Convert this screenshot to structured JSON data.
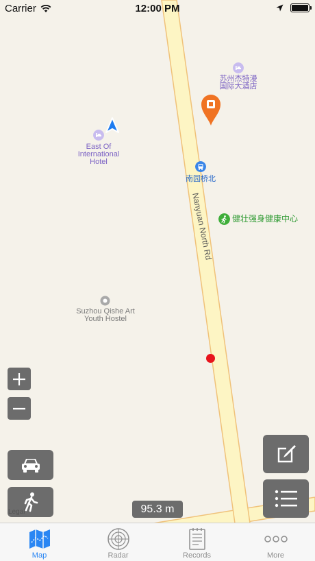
{
  "status_bar": {
    "carrier": "Carrier",
    "time": "12:00 PM"
  },
  "map": {
    "road_name": "Nanyuan North Rd",
    "pois": [
      {
        "id": "suzhou-hotel",
        "label_line1": "苏州杰特漫",
        "label_line2": "国际大酒店",
        "category": "hotel"
      },
      {
        "id": "east-of-international",
        "label_line1": "East Of",
        "label_line2": "International",
        "label_line3": "Hotel",
        "category": "hotel"
      },
      {
        "id": "bus-stop",
        "label_line1": "南园桥北",
        "category": "bus-stop"
      },
      {
        "id": "fitness-center",
        "label_line1": "健壮强身健康中心",
        "category": "fitness"
      },
      {
        "id": "youth-hostel",
        "label_line1": "Suzhou Qishe Art",
        "label_line2": "Youth Hostel",
        "category": "hostel"
      }
    ],
    "legal": "Legal",
    "scale": "95.3 m",
    "colors": {
      "background": "#f5f2ea",
      "road_fill": "#fdf5c4",
      "road_edge": "#f0c27a",
      "pin": "#f07323",
      "track_point": "#e8141c",
      "location_arrow": "#1c7bf0"
    }
  },
  "controls": {
    "zoom_in": "zoom-in",
    "zoom_out": "zoom-out",
    "drive_mode": "car-icon",
    "walk_mode": "walk-icon",
    "edit": "edit-icon",
    "list": "list-icon"
  },
  "tabs": [
    {
      "label": "Map",
      "icon": "map-icon",
      "active": true
    },
    {
      "label": "Radar",
      "icon": "radar-icon",
      "active": false
    },
    {
      "label": "Records",
      "icon": "records-icon",
      "active": false
    },
    {
      "label": "More",
      "icon": "more-icon",
      "active": false
    }
  ]
}
